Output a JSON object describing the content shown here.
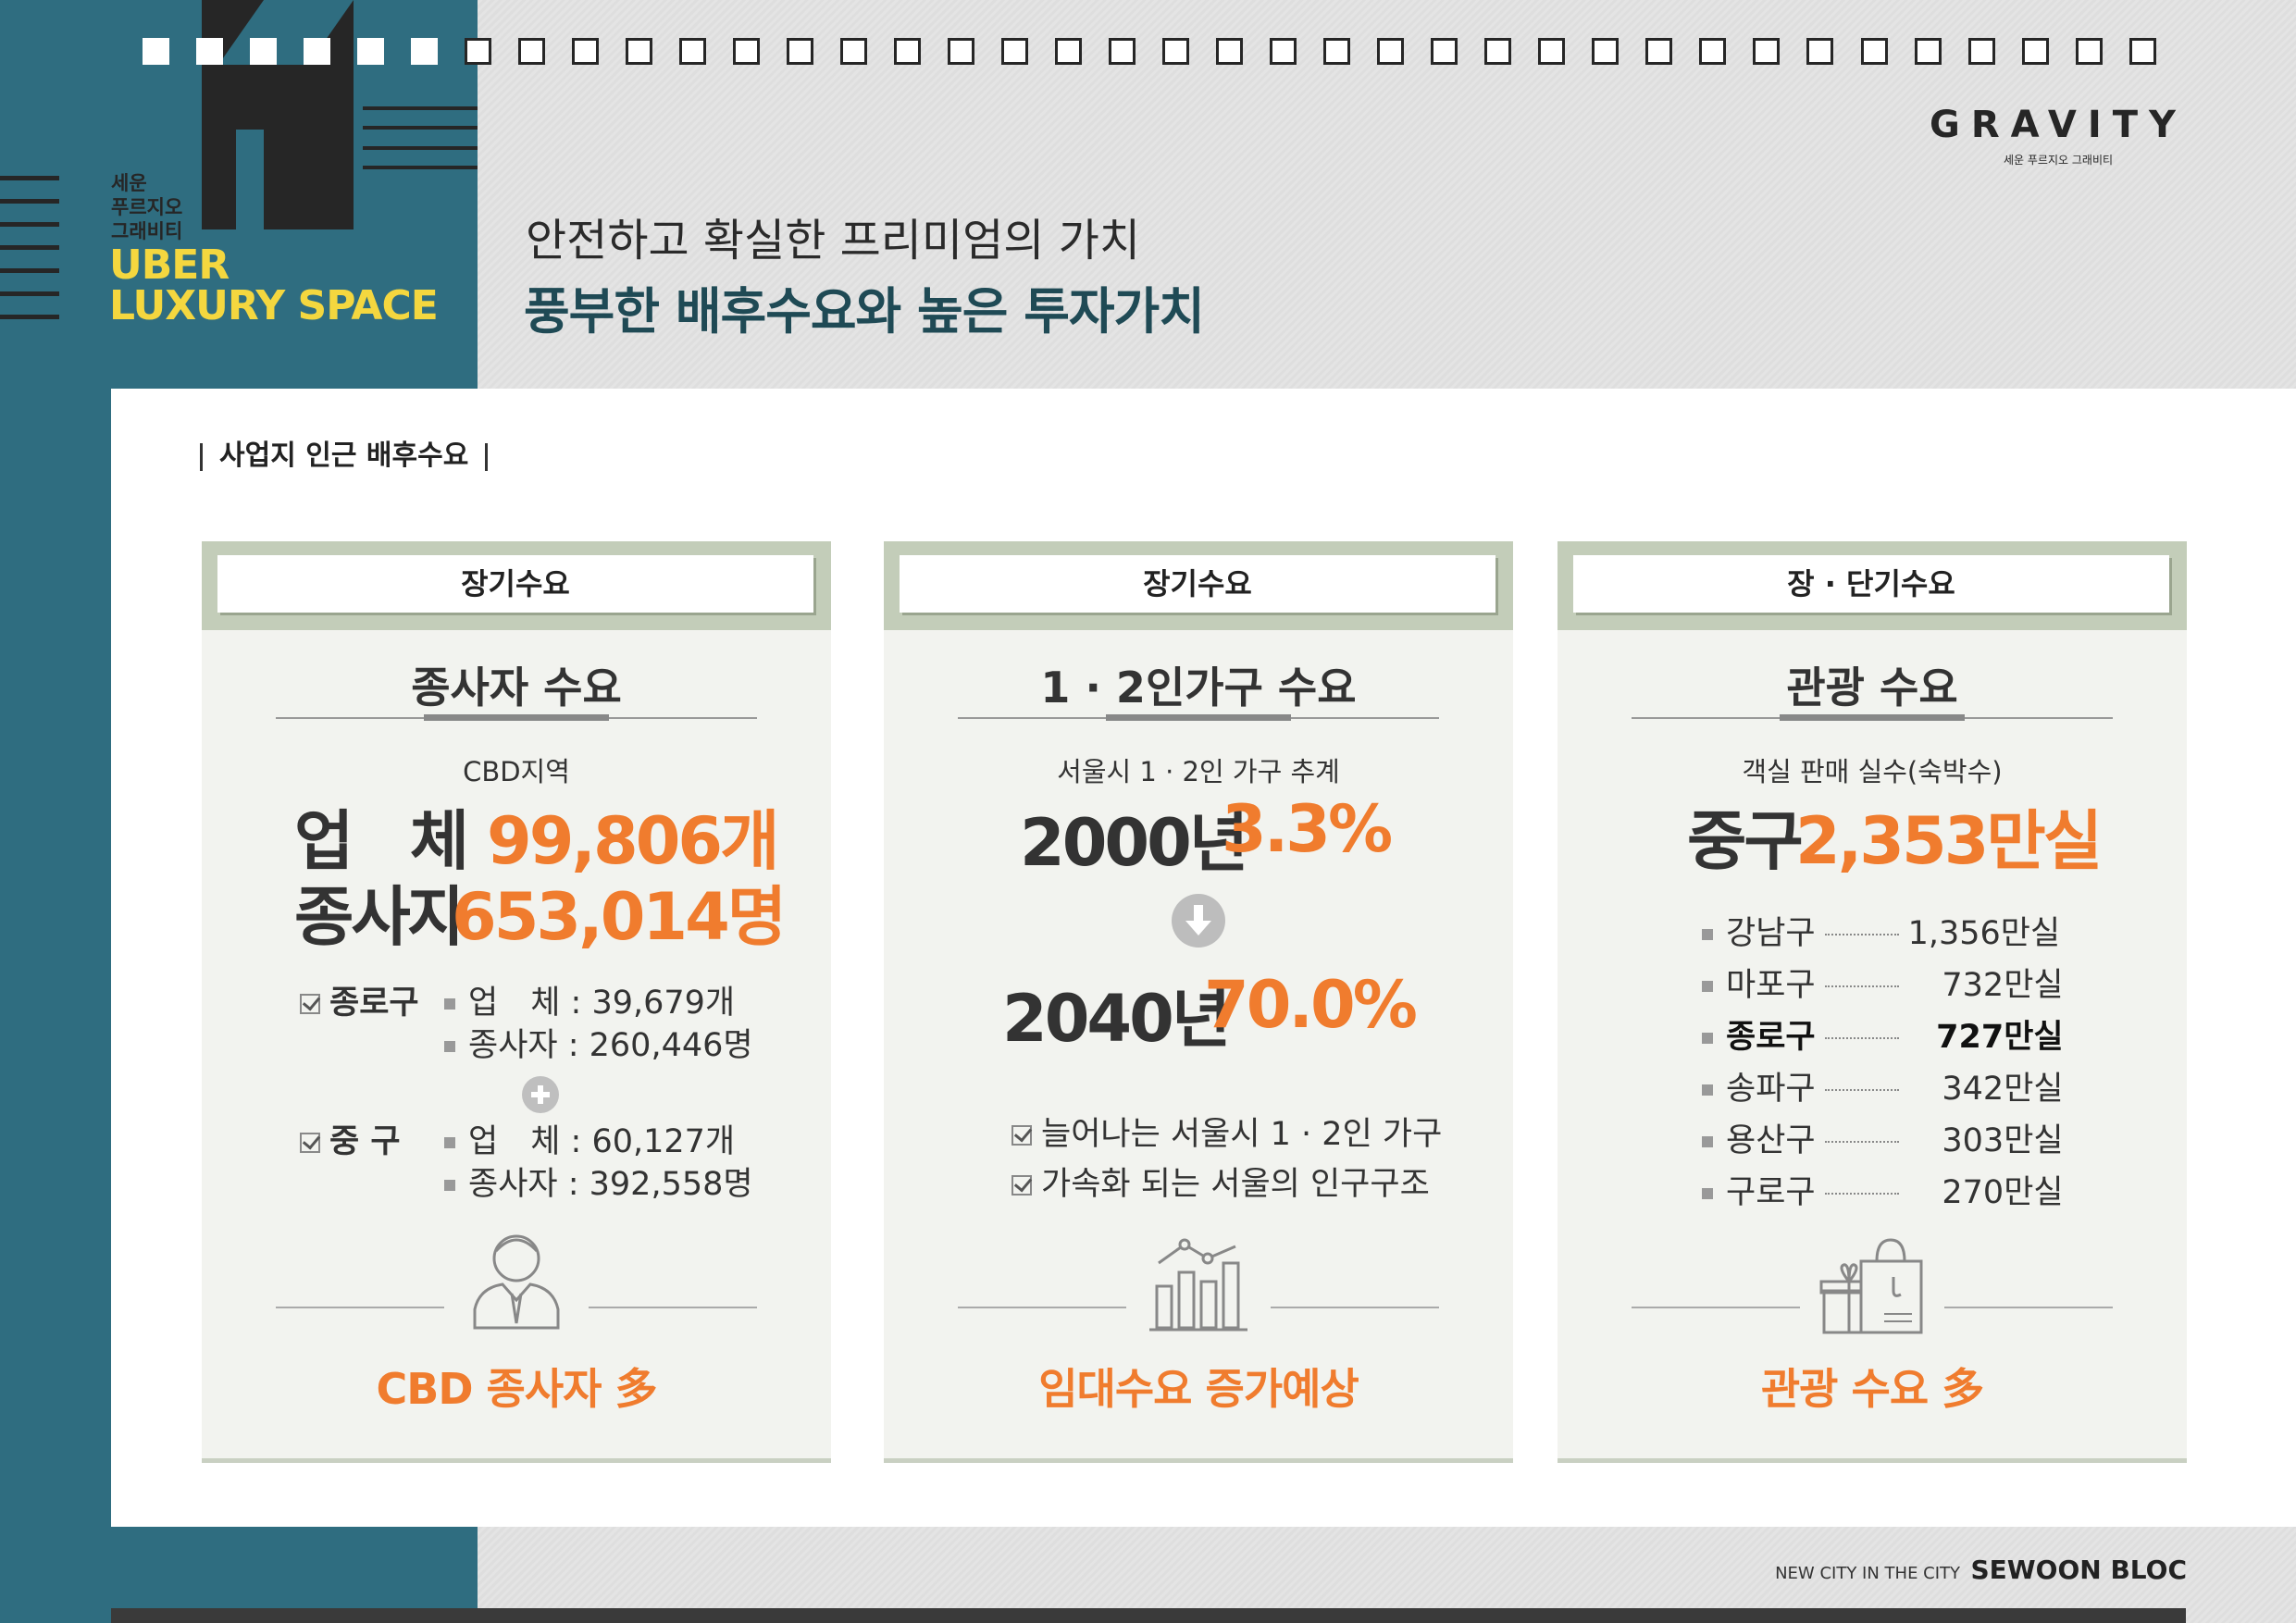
{
  "brand": {
    "small_lines": [
      "세운",
      "푸르지오",
      "그래비티"
    ],
    "big_lines": [
      "UBER",
      "LUXURY SPACE"
    ]
  },
  "logo": {
    "main": "GRAVITY",
    "sub": "세운 푸르지오 그래비티"
  },
  "header": {
    "line1": "안전하고 확실한 프리미엄의 가치",
    "line2": "풍부한 배후수요와 높은 투자가치"
  },
  "section_title": "사업지 인근 배후수요",
  "cards": [
    {
      "tab": "장기수요",
      "title": "종사자 수요",
      "sub": "CBD지역",
      "big1_label": "업 체",
      "big1_value": "99,806개",
      "big2_label": "종사자",
      "big2_value": "653,014명",
      "groups": [
        {
          "name": "종로구",
          "row1": "업　체 :   39,679개",
          "row2": "종사자 : 260,446명"
        },
        {
          "name": "중 구",
          "row1": "업　체 :   60,127개",
          "row2": "종사자 : 392,558명"
        }
      ],
      "footer": "CBD 종사자 多"
    },
    {
      "tab": "장기수요",
      "title": "1 · 2인가구 수요",
      "sub": "서울시 1 · 2인 가구 추계",
      "year1": "2000년",
      "value1": "3.3%",
      "year2": "2040년",
      "value2": "70.0%",
      "notes": [
        "늘어나는 서울시 1 · 2인 가구",
        "가속화 되는 서울의 인구구조"
      ],
      "footer": "임대수요 증가예상"
    },
    {
      "tab": "장 · 단기수요",
      "title": "관광 수요",
      "sub": "객실 판매 실수(숙박수)",
      "big_label": "중구",
      "big_value": "2,353만실",
      "rows": [
        {
          "name": "강남구",
          "value": "1,356만실"
        },
        {
          "name": "마포구",
          "value": "732만실"
        },
        {
          "name": "종로구",
          "value": "727만실"
        },
        {
          "name": "송파구",
          "value": "342만실"
        },
        {
          "name": "용산구",
          "value": "303만실"
        },
        {
          "name": "구로구",
          "value": "270만실"
        }
      ],
      "footer": "관광 수요 多"
    }
  ],
  "footer_note": {
    "small": "NEW CITY IN THE CITY",
    "big": "SEWOON BLOC"
  },
  "colors": {
    "teal": "#2f6d80",
    "orange": "#f07c2e",
    "yellow": "#f4d73f",
    "card_head": "#c3cdb9"
  }
}
